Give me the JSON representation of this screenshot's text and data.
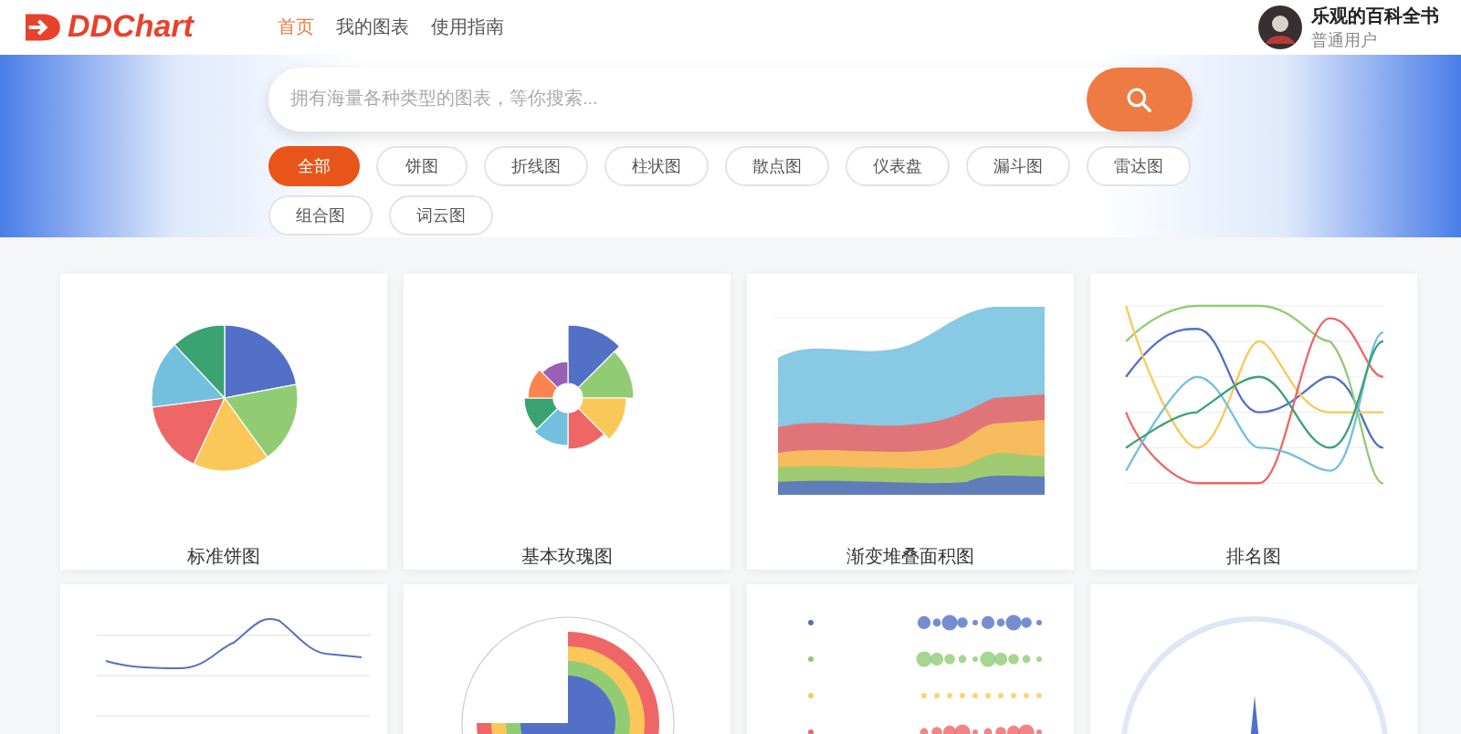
{
  "header": {
    "logo": "DDChart",
    "nav": [
      {
        "label": "首页",
        "selected": true
      },
      {
        "label": "我的图表",
        "selected": false
      },
      {
        "label": "使用指南",
        "selected": false
      }
    ],
    "user": {
      "name": "乐观的百科全书",
      "role": "普通用户"
    }
  },
  "search": {
    "placeholder": "拥有海量各种类型的图表，等你搜索..."
  },
  "categories": [
    {
      "label": "全部",
      "selected": true
    },
    {
      "label": "饼图",
      "selected": false
    },
    {
      "label": "折线图",
      "selected": false
    },
    {
      "label": "柱状图",
      "selected": false
    },
    {
      "label": "散点图",
      "selected": false
    },
    {
      "label": "仪表盘",
      "selected": false
    },
    {
      "label": "漏斗图",
      "selected": false
    },
    {
      "label": "雷达图",
      "selected": false
    },
    {
      "label": "组合图",
      "selected": false
    },
    {
      "label": "词云图",
      "selected": false
    }
  ],
  "cards": [
    {
      "kind": "pie",
      "title": "标准饼图"
    },
    {
      "kind": "rose",
      "title": "基本玫瑰图"
    },
    {
      "kind": "area",
      "title": "渐变堆叠面积图"
    },
    {
      "kind": "rank",
      "title": "排名图"
    },
    {
      "kind": "line"
    },
    {
      "kind": "polar"
    },
    {
      "kind": "bubble"
    },
    {
      "kind": "gauge"
    }
  ]
}
